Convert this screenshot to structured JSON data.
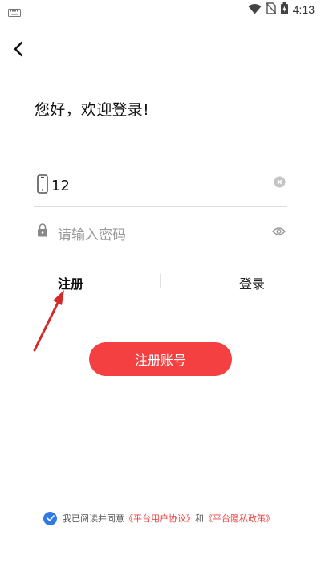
{
  "status_bar": {
    "time": "4:13",
    "left_icon": "keyboard-icon",
    "icons": [
      "wifi-icon",
      "no-sim-icon",
      "battery-charging-icon"
    ]
  },
  "header": {
    "back_icon": "chevron-left-icon"
  },
  "greeting": "您好，欢迎登录!",
  "phone_field": {
    "icon": "phone-icon",
    "value": "12",
    "clear_icon": "clear-icon"
  },
  "password_field": {
    "icon": "lock-icon",
    "placeholder": "请输入密码",
    "toggle_icon": "eye-icon"
  },
  "tabs": {
    "register": "注册",
    "login": "登录"
  },
  "register_button": {
    "label": "注册账号"
  },
  "agreement": {
    "prefix": "我已阅读并同意",
    "user_agreement": "《平台用户协议》",
    "conjunction": "和",
    "privacy_policy": "《平台隐私政策》"
  },
  "colors": {
    "accent_red": "#f44041",
    "link_red": "#e84040",
    "checkbox_blue": "#2f7ae5",
    "annotation_arrow": "#d62a2a"
  }
}
